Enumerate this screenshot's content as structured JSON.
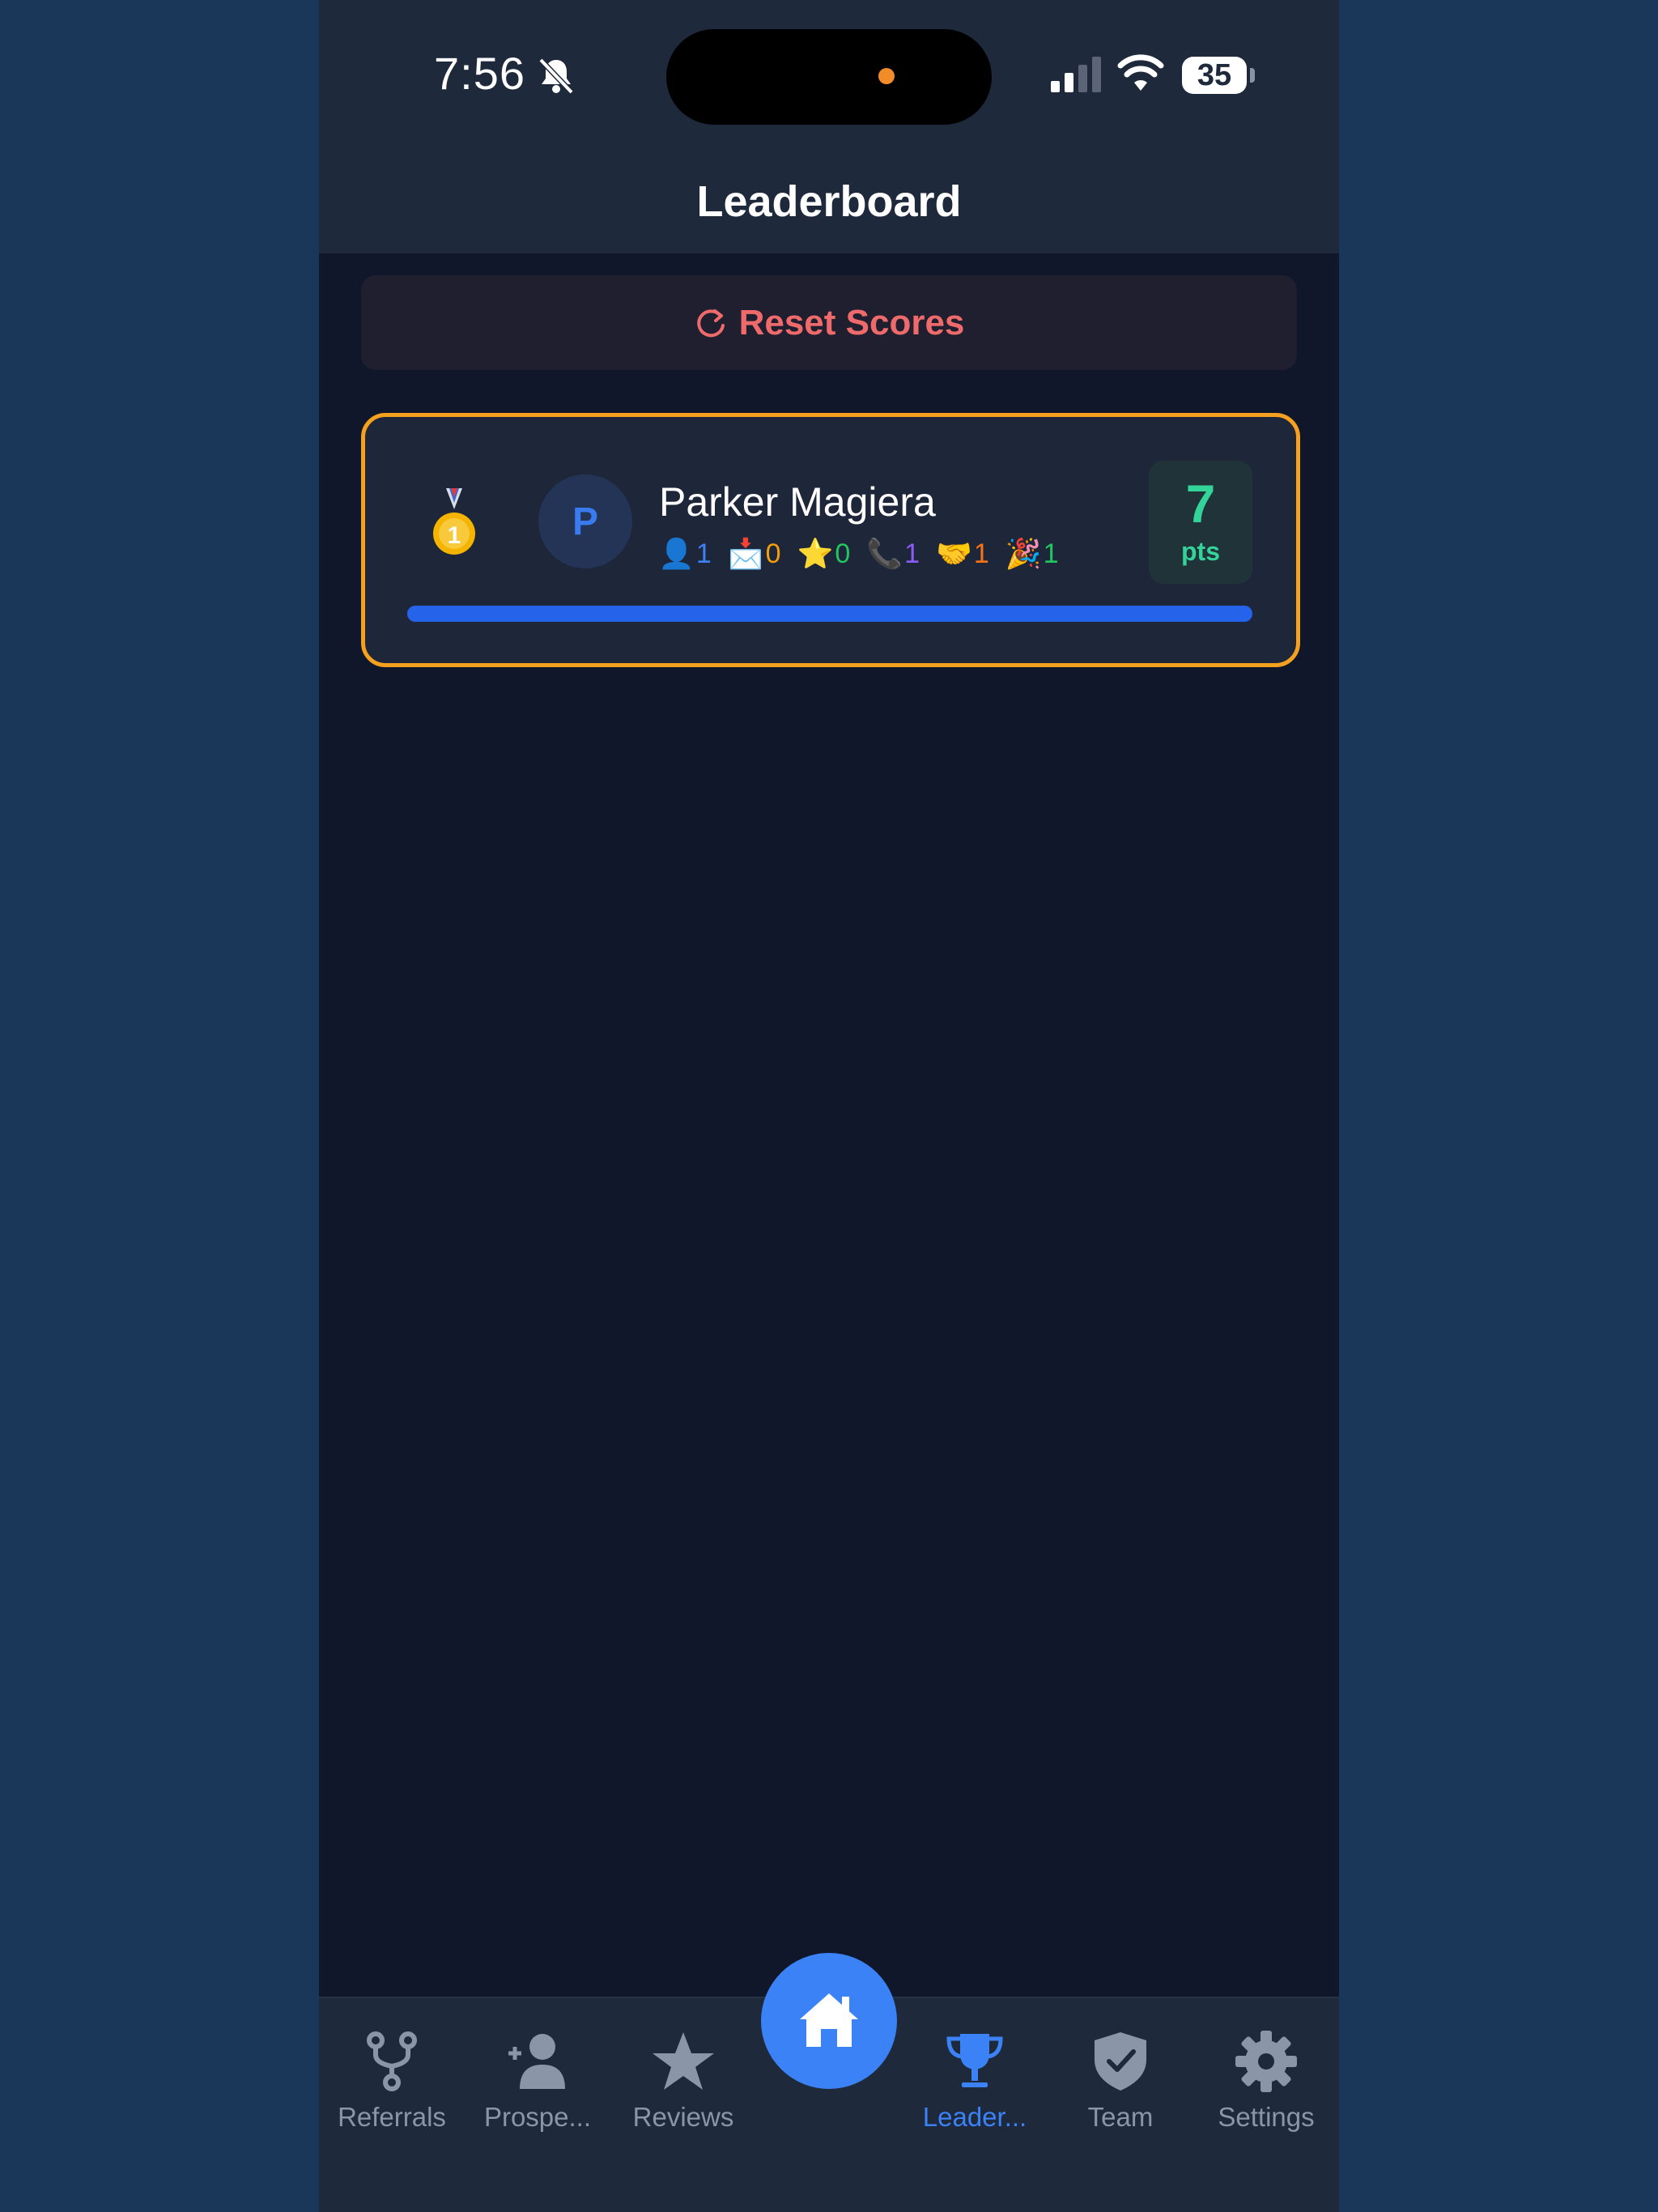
{
  "status_bar": {
    "time": "7:56",
    "battery": "35",
    "battery_level": 0.35,
    "icons": [
      "bell-slash-icon",
      "signal-icon",
      "wifi-icon",
      "battery-icon"
    ]
  },
  "header": {
    "title": "Leaderboard"
  },
  "reset_button": {
    "label": "Reset Scores",
    "icon": "refresh-icon",
    "color": "#ef6b6b"
  },
  "leaderboard": [
    {
      "rank_icon": "gold-medal-icon",
      "avatar_initial": "P",
      "name": "Parker Magiera",
      "stats": [
        {
          "icon": "person-icon",
          "emoji": "👤",
          "value": "1",
          "color": "#3b82f6"
        },
        {
          "icon": "envelope-icon",
          "emoji": "📩",
          "value": "0",
          "color": "#f59e0b"
        },
        {
          "icon": "star-icon",
          "emoji": "⭐",
          "value": "0",
          "color": "#22c55e"
        },
        {
          "icon": "phone-icon",
          "emoji": "📞",
          "value": "1",
          "color": "#8b5cf6"
        },
        {
          "icon": "handshake-icon",
          "emoji": "🤝",
          "value": "1",
          "color": "#f97316"
        },
        {
          "icon": "party-icon",
          "emoji": "🎉",
          "value": "1",
          "color": "#22c55e"
        }
      ],
      "points": "7",
      "points_label": "pts",
      "progress": 1.0
    }
  ],
  "tabbar": {
    "items": [
      {
        "label": "Referrals",
        "icon": "fork-icon"
      },
      {
        "label": "Prospe...",
        "icon": "add-person-icon"
      },
      {
        "label": "Reviews",
        "icon": "star-icon"
      },
      {
        "label": "Leader...",
        "icon": "trophy-icon",
        "active": true
      },
      {
        "label": "Team",
        "icon": "shield-check-icon"
      },
      {
        "label": "Settings",
        "icon": "gear-icon"
      }
    ],
    "home_icon": "home-icon",
    "accent": "#3b82f6",
    "inactive": "#8a96a8"
  }
}
